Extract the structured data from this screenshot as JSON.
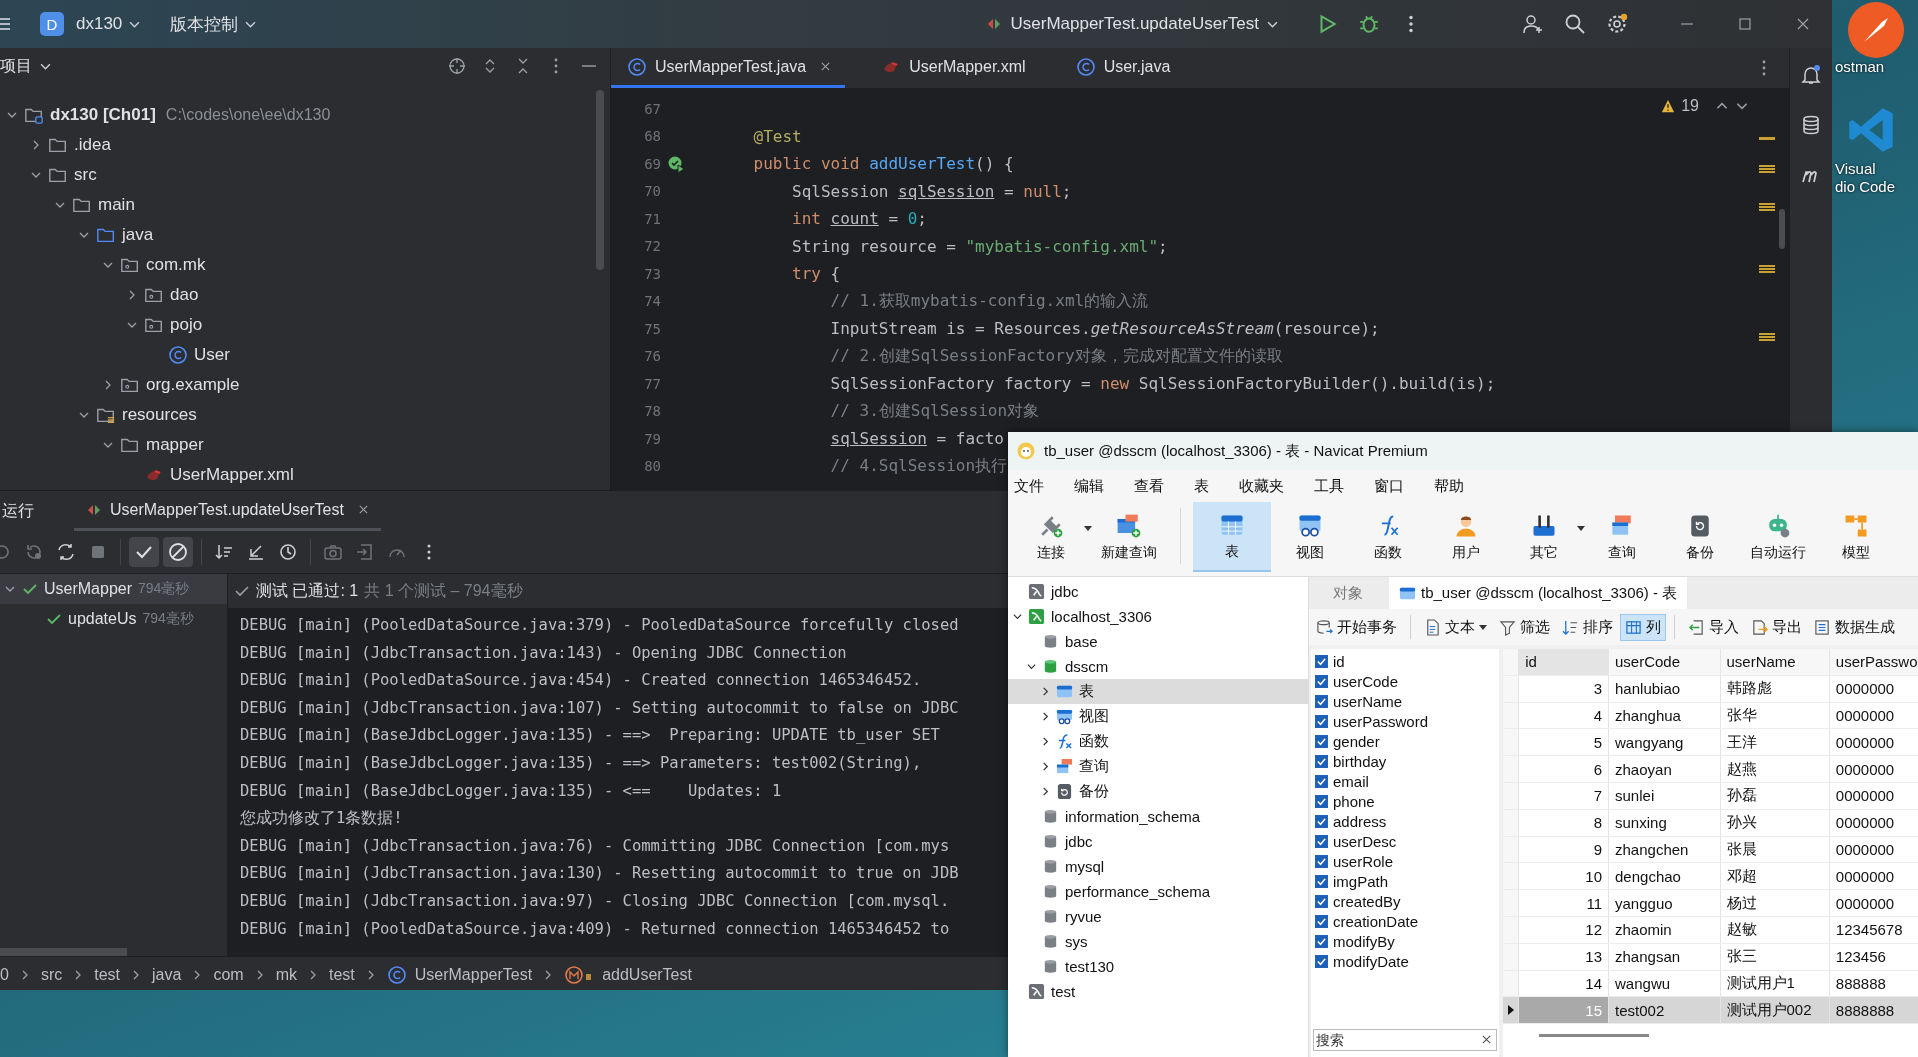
{
  "desktop": {
    "icons": [
      {
        "kind": "postman",
        "lines": [
          "ostman"
        ]
      },
      {
        "kind": "vscode",
        "lines": [
          "Visual",
          "dio Code"
        ]
      }
    ]
  },
  "ide": {
    "toolbar": {
      "project_badge": "D",
      "project": "dx130",
      "vcs": "版本控制",
      "run_config": "UserMapperTest.updateUserTest",
      "settings_badge": true
    },
    "project_panel": {
      "title": "项目",
      "tree": [
        {
          "label": "dx130 [Ch01]",
          "path": "C:\\codes\\one\\ee\\dx130",
          "kind": "module",
          "expanded": true,
          "children": [
            {
              "label": ".idea",
              "kind": "folder",
              "expanded": false
            },
            {
              "label": "src",
              "kind": "folder",
              "expanded": true,
              "children": [
                {
                  "label": "main",
                  "kind": "folder",
                  "expanded": true,
                  "children": [
                    {
                      "label": "java",
                      "kind": "source",
                      "expanded": true,
                      "children": [
                        {
                          "label": "com.mk",
                          "kind": "package",
                          "expanded": true,
                          "children": [
                            {
                              "label": "dao",
                              "kind": "package",
                              "expanded": false
                            },
                            {
                              "label": "pojo",
                              "kind": "package",
                              "expanded": true,
                              "children": [
                                {
                                  "label": "User",
                                  "kind": "class"
                                }
                              ]
                            }
                          ]
                        },
                        {
                          "label": "org.example",
                          "kind": "package",
                          "expanded": false
                        }
                      ]
                    },
                    {
                      "label": "resources",
                      "kind": "resources",
                      "expanded": true,
                      "children": [
                        {
                          "label": "mapper",
                          "kind": "folder",
                          "expanded": true,
                          "children": [
                            {
                              "label": "UserMapper.xml",
                              "kind": "xml"
                            }
                          ]
                        }
                      ]
                    }
                  ]
                }
              ]
            }
          ]
        }
      ]
    },
    "editor": {
      "tabs": [
        {
          "label": "UserMapperTest.java",
          "kind": "class",
          "selected": true,
          "closable": true
        },
        {
          "label": "UserMapper.xml",
          "kind": "xml",
          "selected": false,
          "closable": false
        },
        {
          "label": "User.java",
          "kind": "class",
          "selected": false,
          "closable": false
        }
      ],
      "warnings": "19",
      "lines": [
        {
          "number": "67",
          "marker": false
        },
        {
          "number": "68",
          "marker": false,
          "tokens": [
            {
              "kind": "ann",
              "t": "@Test"
            }
          ]
        },
        {
          "number": "69",
          "marker": true,
          "tokens": [
            {
              "kind": "kw",
              "t": "public void "
            },
            {
              "kind": "fn",
              "t": "addUserTest"
            },
            {
              "kind": "plain",
              "t": "() {"
            }
          ],
          "children": [
            {
              "number": "70",
              "marker": false,
              "tokens": [
                {
                  "kind": "plain",
                  "t": "SqlSession "
                },
                {
                  "kind": "under",
                  "t": "sqlSession"
                },
                {
                  "kind": "plain",
                  "t": " = "
                },
                {
                  "kind": "kw",
                  "t": "null"
                },
                {
                  "kind": "plain",
                  "t": ";"
                }
              ]
            },
            {
              "number": "71",
              "marker": false,
              "tokens": [
                {
                  "kind": "kw",
                  "t": "int "
                },
                {
                  "kind": "under",
                  "t": "count"
                },
                {
                  "kind": "plain",
                  "t": " = "
                },
                {
                  "kind": "num",
                  "t": "0"
                },
                {
                  "kind": "plain",
                  "t": ";"
                }
              ]
            },
            {
              "number": "72",
              "marker": false,
              "tokens": [
                {
                  "kind": "plain",
                  "t": "String resource = "
                },
                {
                  "kind": "str",
                  "t": "\"mybatis-config.xml\""
                },
                {
                  "kind": "plain",
                  "t": ";"
                }
              ]
            },
            {
              "number": "73",
              "marker": false,
              "tokens": [
                {
                  "kind": "kw",
                  "t": "try"
                },
                {
                  "kind": "plain",
                  "t": " {"
                }
              ],
              "children": [
                {
                  "number": "74",
                  "marker": false,
                  "tokens": [
                    {
                      "kind": "comment",
                      "t": "// 1.获取mybatis-config.xml的输入流"
                    }
                  ]
                },
                {
                  "number": "75",
                  "marker": false,
                  "tokens": [
                    {
                      "kind": "plain",
                      "t": "InputStream is = Resources."
                    },
                    {
                      "kind": "italic",
                      "t": "getResourceAsStream"
                    },
                    {
                      "kind": "plain",
                      "t": "(resource);"
                    }
                  ]
                },
                {
                  "number": "76",
                  "marker": false,
                  "tokens": [
                    {
                      "kind": "comment",
                      "t": "// 2.创建SqlSessionFactory对象，完成对配置文件的读取"
                    }
                  ]
                },
                {
                  "number": "77",
                  "marker": false,
                  "tokens": [
                    {
                      "kind": "plain",
                      "t": "SqlSessionFactory factory = "
                    },
                    {
                      "kind": "kw",
                      "t": "new"
                    },
                    {
                      "kind": "plain",
                      "t": " SqlSessionFactoryBuilder().build(is);"
                    }
                  ]
                },
                {
                  "number": "78",
                  "marker": false,
                  "tokens": [
                    {
                      "kind": "comment",
                      "t": "// 3.创建SqlSession对象"
                    }
                  ]
                },
                {
                  "number": "79",
                  "marker": false,
                  "tokens": [
                    {
                      "kind": "under",
                      "t": "sqlSession"
                    },
                    {
                      "kind": "plain",
                      "t": " = facto"
                    }
                  ]
                },
                {
                  "number": "80",
                  "marker": false,
                  "tokens": [
                    {
                      "kind": "comment",
                      "t": "// 4.SqlSession执行"
                    }
                  ]
                }
              ]
            }
          ]
        }
      ]
    },
    "run_panel": {
      "title": "运行",
      "tab": "UserMapperTest.updateUserTest",
      "passed_filter": {
        "selected": true
      },
      "ignored_filter": {
        "selected": true
      },
      "tests": [
        {
          "name": "UserMapper",
          "time": "794毫秒",
          "passed": true,
          "expanded": true,
          "children": [
            {
              "name": "updateUs",
              "time": "794毫秒",
              "passed": true
            }
          ]
        }
      ],
      "status": {
        "main": "测试 已通过: 1",
        "detail": "共 1 个测试 – 794毫秒",
        "passed": true
      },
      "console": [
        "DEBUG [main] (PooledDataSource.java:379) - PooledDataSource forcefully closed",
        "DEBUG [main] (JdbcTransaction.java:143) - Opening JDBC Connection",
        "DEBUG [main] (PooledDataSource.java:454) - Created connection 1465346452.",
        "DEBUG [main] (JdbcTransaction.java:107) - Setting autocommit to false on JDBC",
        "DEBUG [main] (BaseJdbcLogger.java:135) - ==>  Preparing: UPDATE tb_user SET",
        "DEBUG [main] (BaseJdbcLogger.java:135) - ==> Parameters: test002(String),",
        "DEBUG [main] (BaseJdbcLogger.java:135) - <==    Updates: 1",
        "您成功修改了1条数据!",
        "DEBUG [main] (JdbcTransaction.java:76) - Committing JDBC Connection [com.mys",
        "DEBUG [main] (JdbcTransaction.java:130) - Resetting autocommit to true on JDB",
        "DEBUG [main] (JdbcTransaction.java:97) - Closing JDBC Connection [com.mysql.",
        "DEBUG [main] (PooledDataSource.java:409) - Returned connection 1465346452 to"
      ]
    },
    "breadcrumb": [
      {
        "label": "0"
      },
      {
        "label": "src"
      },
      {
        "label": "test"
      },
      {
        "label": "java"
      },
      {
        "label": "com"
      },
      {
        "label": "mk"
      },
      {
        "label": "test"
      },
      {
        "label": "UserMapperTest",
        "kind": "class"
      },
      {
        "label": "addUserTest",
        "kind": "method"
      }
    ]
  },
  "navicat": {
    "title": "tb_user @dsscm (localhost_3306) - 表 - Navicat Premium",
    "menu": [
      "文件",
      "编辑",
      "查看",
      "表",
      "收藏夹",
      "工具",
      "窗口",
      "帮助"
    ],
    "toolbar": [
      {
        "label": "连接",
        "kind": "connection",
        "selected": false,
        "dropdown": true,
        "separator_before": false
      },
      {
        "label": "新建查询",
        "kind": "new_query",
        "selected": false,
        "dropdown": false,
        "separator_before": false
      },
      {
        "label": "表",
        "kind": "table",
        "selected": true,
        "dropdown": false,
        "separator_before": true
      },
      {
        "label": "视图",
        "kind": "view",
        "selected": false,
        "dropdown": false,
        "separator_before": false
      },
      {
        "label": "函数",
        "kind": "function",
        "selected": false,
        "dropdown": false,
        "separator_before": false
      },
      {
        "label": "用户",
        "kind": "user",
        "selected": false,
        "dropdown": false,
        "separator_before": false
      },
      {
        "label": "其它",
        "kind": "other",
        "selected": false,
        "dropdown": true,
        "separator_before": false
      },
      {
        "label": "查询",
        "kind": "query",
        "selected": false,
        "dropdown": false,
        "separator_before": false
      },
      {
        "label": "备份",
        "kind": "backup",
        "selected": false,
        "dropdown": false,
        "separator_before": false
      },
      {
        "label": "自动运行",
        "kind": "automation",
        "selected": false,
        "dropdown": false,
        "separator_before": false
      },
      {
        "label": "模型",
        "kind": "model",
        "selected": false,
        "dropdown": false,
        "separator_before": false
      }
    ],
    "tree": [
      {
        "label": "jdbc",
        "kind": "connection",
        "connected": false
      },
      {
        "label": "localhost_3306",
        "kind": "connection",
        "connected": true,
        "expanded": true,
        "children": [
          {
            "label": "base",
            "kind": "database",
            "open": false
          },
          {
            "label": "dsscm",
            "kind": "database",
            "open": true,
            "expanded": true,
            "children": [
              {
                "label": "表",
                "kind": "tables",
                "expanded": false,
                "selected": true
              },
              {
                "label": "视图",
                "kind": "views",
                "expanded": false,
                "selected": false
              },
              {
                "label": "函数",
                "kind": "functions",
                "expanded": false,
                "selected": false
              },
              {
                "label": "查询",
                "kind": "queries",
                "expanded": false,
                "selected": false
              },
              {
                "label": "备份",
                "kind": "backups",
                "expanded": false,
                "selected": false
              }
            ]
          },
          {
            "label": "information_schema",
            "kind": "database",
            "open": false
          },
          {
            "label": "jdbc",
            "kind": "database",
            "open": false
          },
          {
            "label": "mysql",
            "kind": "database",
            "open": false
          },
          {
            "label": "performance_schema",
            "kind": "database",
            "open": false
          },
          {
            "label": "ryvue",
            "kind": "database",
            "open": false
          },
          {
            "label": "sys",
            "kind": "database",
            "open": false
          },
          {
            "label": "test130",
            "kind": "database",
            "open": false
          }
        ]
      },
      {
        "label": "test",
        "kind": "connection",
        "connected": false
      }
    ],
    "tabs": [
      {
        "label": "对象",
        "kind": "objects",
        "selected": false
      },
      {
        "label": "tb_user @dsscm (localhost_3306) - 表",
        "kind": "table",
        "selected": true
      }
    ],
    "actions": [
      {
        "label": "开始事务",
        "kind": "transaction",
        "selected": false,
        "dropdown": false,
        "separator_before": false
      },
      {
        "label": "文本",
        "kind": "text",
        "selected": false,
        "dropdown": true,
        "separator_before": true
      },
      {
        "label": "筛选",
        "kind": "filter",
        "selected": false,
        "dropdown": false,
        "separator_before": false
      },
      {
        "label": "排序",
        "kind": "sort",
        "selected": false,
        "dropdown": false,
        "separator_before": false
      },
      {
        "label": "列",
        "kind": "columns",
        "selected": true,
        "dropdown": false,
        "separator_before": false
      },
      {
        "label": "导入",
        "kind": "import",
        "selected": false,
        "dropdown": false,
        "separator_before": true
      },
      {
        "label": "导出",
        "kind": "export",
        "selected": false,
        "dropdown": false,
        "separator_before": false
      },
      {
        "label": "数据生成",
        "kind": "generate",
        "selected": false,
        "dropdown": false,
        "separator_before": false
      }
    ],
    "columns_list": [
      {
        "name": "id",
        "checked": true
      },
      {
        "name": "userCode",
        "checked": true
      },
      {
        "name": "userName",
        "checked": true
      },
      {
        "name": "userPassword",
        "checked": true
      },
      {
        "name": "gender",
        "checked": true
      },
      {
        "name": "birthday",
        "checked": true
      },
      {
        "name": "email",
        "checked": true
      },
      {
        "name": "phone",
        "checked": true
      },
      {
        "name": "address",
        "checked": true
      },
      {
        "name": "userDesc",
        "checked": true
      },
      {
        "name": "userRole",
        "checked": true
      },
      {
        "name": "imgPath",
        "checked": true
      },
      {
        "name": "createdBy",
        "checked": true
      },
      {
        "name": "creationDate",
        "checked": true
      },
      {
        "name": "modifyBy",
        "checked": true
      },
      {
        "name": "modifyDate",
        "checked": true
      }
    ],
    "search": {
      "placeholder": "搜索"
    },
    "grid": {
      "columns": [
        "id",
        "userCode",
        "userName",
        "userPasswo"
      ],
      "rows": [
        {
          "cells": [
            "3",
            "hanlubiao",
            "韩路彪",
            "0000000"
          ],
          "selected": false
        },
        {
          "cells": [
            "4",
            "zhanghua",
            "张华",
            "0000000"
          ],
          "selected": false
        },
        {
          "cells": [
            "5",
            "wangyang",
            "王洋",
            "0000000"
          ],
          "selected": false
        },
        {
          "cells": [
            "6",
            "zhaoyan",
            "赵燕",
            "0000000"
          ],
          "selected": false
        },
        {
          "cells": [
            "7",
            "sunlei",
            "孙磊",
            "0000000"
          ],
          "selected": false
        },
        {
          "cells": [
            "8",
            "sunxing",
            "孙兴",
            "0000000"
          ],
          "selected": false
        },
        {
          "cells": [
            "9",
            "zhangchen",
            "张晨",
            "0000000"
          ],
          "selected": false
        },
        {
          "cells": [
            "10",
            "dengchao",
            "邓超",
            "0000000"
          ],
          "selected": false
        },
        {
          "cells": [
            "11",
            "yangguo",
            "杨过",
            "0000000"
          ],
          "selected": false
        },
        {
          "cells": [
            "12",
            "zhaomin",
            "赵敏",
            "12345678"
          ],
          "selected": false
        },
        {
          "cells": [
            "13",
            "zhangsan",
            "张三",
            "123456"
          ],
          "selected": false
        },
        {
          "cells": [
            "14",
            "wangwu",
            "测试用户1",
            "888888"
          ],
          "selected": false
        },
        {
          "cells": [
            "15",
            "test002",
            "测试用户002",
            "8888888"
          ],
          "selected": true
        }
      ]
    }
  }
}
